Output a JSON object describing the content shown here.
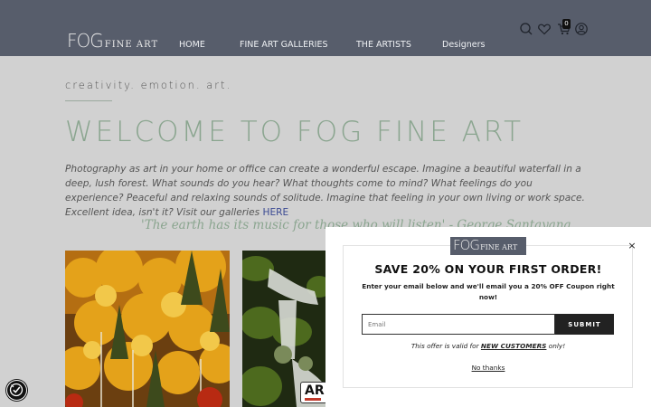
{
  "header": {
    "logo_main": "FOG",
    "logo_sub": "FINE ART",
    "nav": [
      "HOME",
      "FINE ART GALLERIES",
      "THE ARTISTS",
      "Designers"
    ],
    "cart_count": "0",
    "icons": [
      "search-icon",
      "heart-icon",
      "cart-icon",
      "user-icon"
    ]
  },
  "main": {
    "tagline": "creativity. emotion. art.",
    "welcome": "WELCOME TO FOG FINE ART",
    "intro_text": "Photography as art in your home or office can create a wonderful escape. Imagine a beautiful waterfall in a deep, lush forest. What sounds do you hear? What thoughts come to mind? What feelings do you experience? Peaceful and relaxing sounds of solitude. Imagine that feeling in your  own living or work space. Excellent idea, isn't it? Visit our galleries ",
    "intro_link": "HERE",
    "quote": "'The earth has its music for those who will listen' - George Santayana",
    "badge_text": "AR"
  },
  "popup": {
    "logo_main": "FOG",
    "logo_sub": "FINE ART",
    "heading": "SAVE 20% ON YOUR FIRST ORDER!",
    "description": "Enter your email below and we'll email you a 20% OFF Coupon right now!",
    "email_placeholder": "Email",
    "submit_label": "SUBMIT",
    "offer_prefix": "This offer is valid for ",
    "offer_highlight": "NEW CUSTOMERS",
    "offer_suffix": " only!",
    "no_thanks": "No thanks",
    "close_symbol": "×"
  },
  "colors": {
    "header_bg": "#575d6b",
    "page_bg": "#d1d1d1",
    "accent_green": "#8aa58f",
    "link_blue": "#3b4a93"
  }
}
